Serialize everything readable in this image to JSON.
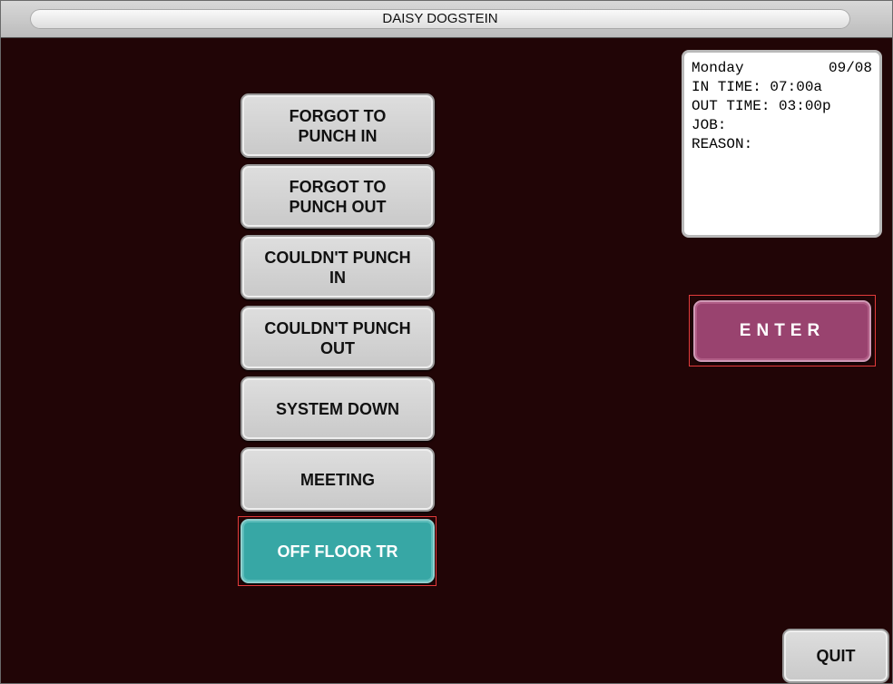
{
  "window": {
    "title": "DAISY DOGSTEIN"
  },
  "reasons": [
    {
      "label": "FORGOT TO\nPUNCH IN",
      "selected": false
    },
    {
      "label": "FORGOT TO\nPUNCH OUT",
      "selected": false
    },
    {
      "label": "COULDN'T PUNCH\nIN",
      "selected": false
    },
    {
      "label": "COULDN'T PUNCH\nOUT",
      "selected": false
    },
    {
      "label": "SYSTEM DOWN",
      "selected": false
    },
    {
      "label": "MEETING",
      "selected": false
    },
    {
      "label": "OFF FLOOR TR",
      "selected": true
    }
  ],
  "info": {
    "day": "Monday",
    "date": "09/08",
    "in_time": "IN TIME: 07:00a",
    "out_time": "OUT TIME: 03:00p",
    "job": "JOB:",
    "reason": "REASON:"
  },
  "actions": {
    "enter_label": "ENTER",
    "quit_label": "QUIT"
  },
  "colors": {
    "background": "#210506",
    "selected_reason": "#37a7a5",
    "enter_button": "#99436f",
    "highlight_outline": "#e23b3b"
  }
}
